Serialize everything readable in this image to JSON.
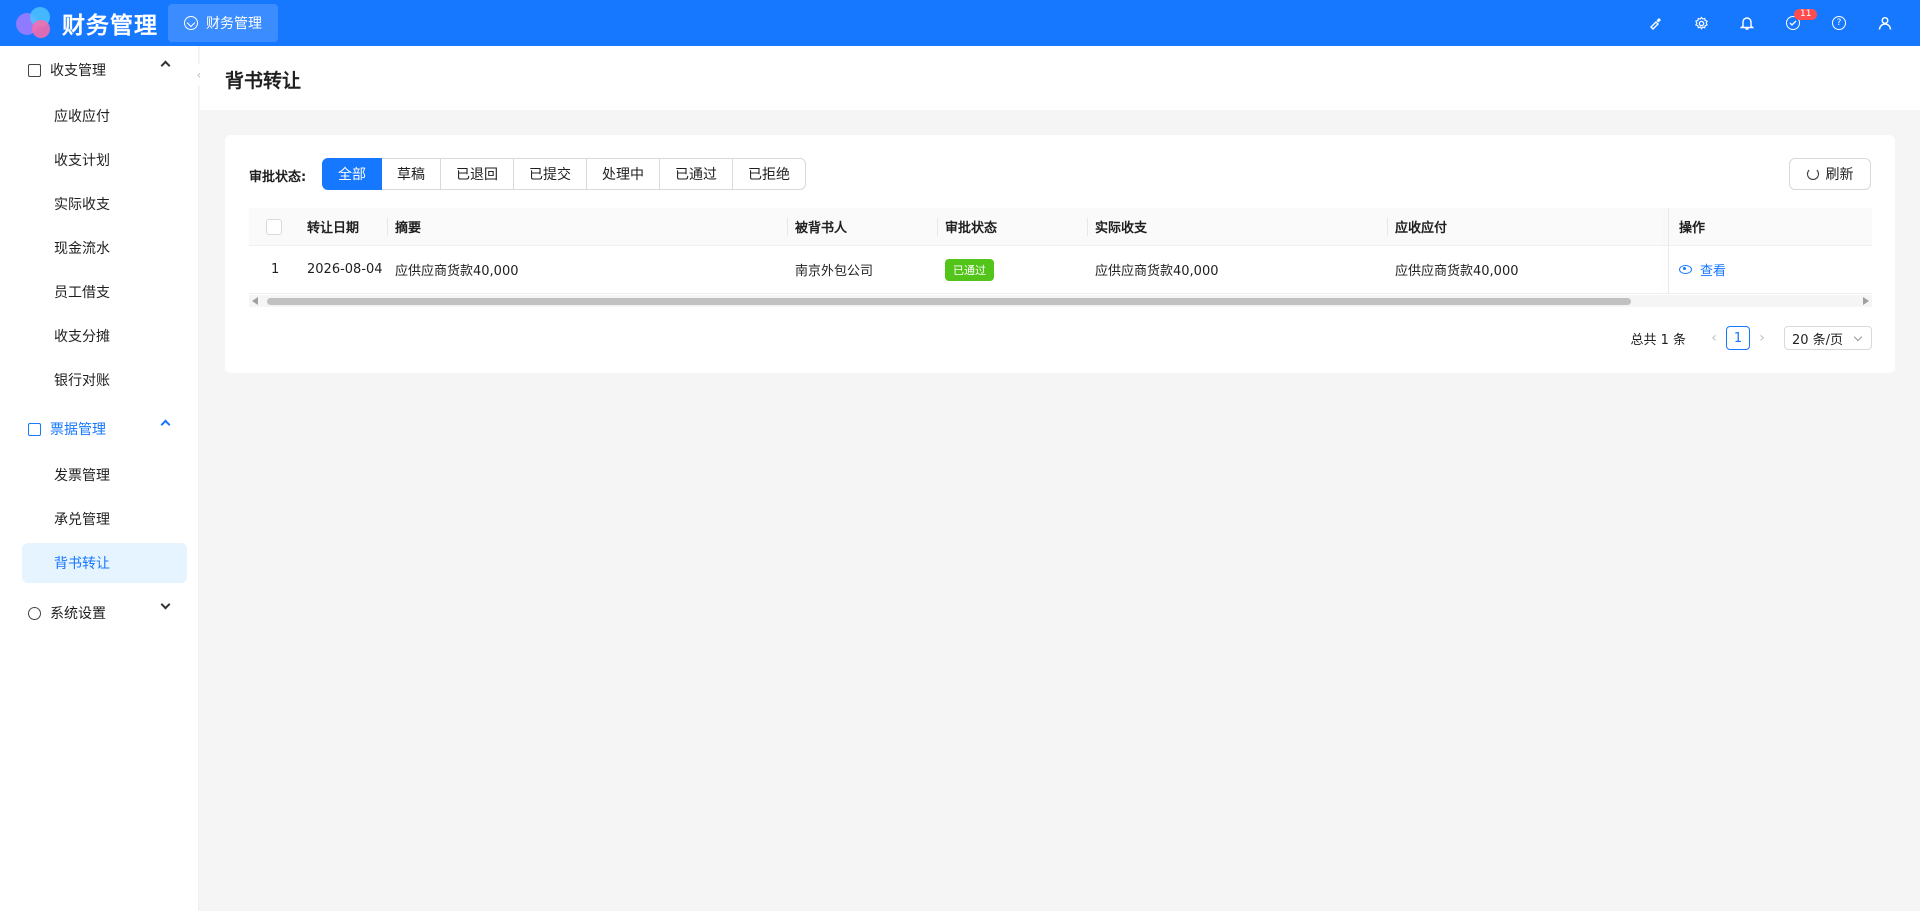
{
  "header": {
    "app_name": "财务管理",
    "module_tab": "财务管理",
    "notification_count": "11",
    "icons": [
      "brush-icon",
      "gear-icon",
      "bell-icon",
      "message-icon",
      "help-icon",
      "user-icon"
    ]
  },
  "sidebar": {
    "groups": [
      {
        "label": "收支管理",
        "expanded": true,
        "items": [
          "应收应付",
          "收支计划",
          "实际收支",
          "现金流水",
          "员工借支",
          "收支分摊",
          "银行对账"
        ]
      },
      {
        "label": "票据管理",
        "expanded": true,
        "active": true,
        "items": [
          "发票管理",
          "承兑管理",
          "背书转让"
        ]
      },
      {
        "label": "系统设置",
        "expanded": false,
        "items": []
      }
    ],
    "selected_item": "背书转让"
  },
  "page": {
    "title": "背书转让"
  },
  "filter": {
    "label": "审批状态:",
    "options": [
      "全部",
      "草稿",
      "已退回",
      "已提交",
      "处理中",
      "已通过",
      "已拒绝"
    ],
    "selected": "全部"
  },
  "toolbar": {
    "refresh_label": "刷新"
  },
  "table": {
    "columns": [
      "转让日期",
      "摘要",
      "被背书人",
      "审批状态",
      "实际收支",
      "应收应付",
      "操作"
    ],
    "rows": [
      {
        "index": "1",
        "date": "2026-08-04",
        "summary": "应供应商货款40,000",
        "endorsee": "南京外包公司",
        "status": "已通过",
        "actual": "应供应商货款40,000",
        "receivable": "应供应商货款40,000",
        "action": "查看"
      }
    ]
  },
  "pagination": {
    "total": "总共 1 条",
    "current_page": "1",
    "page_size": "20 条/页"
  },
  "colors": {
    "primary": "#1677ff",
    "success": "#52c41a",
    "badge": "#ff4d4f"
  }
}
